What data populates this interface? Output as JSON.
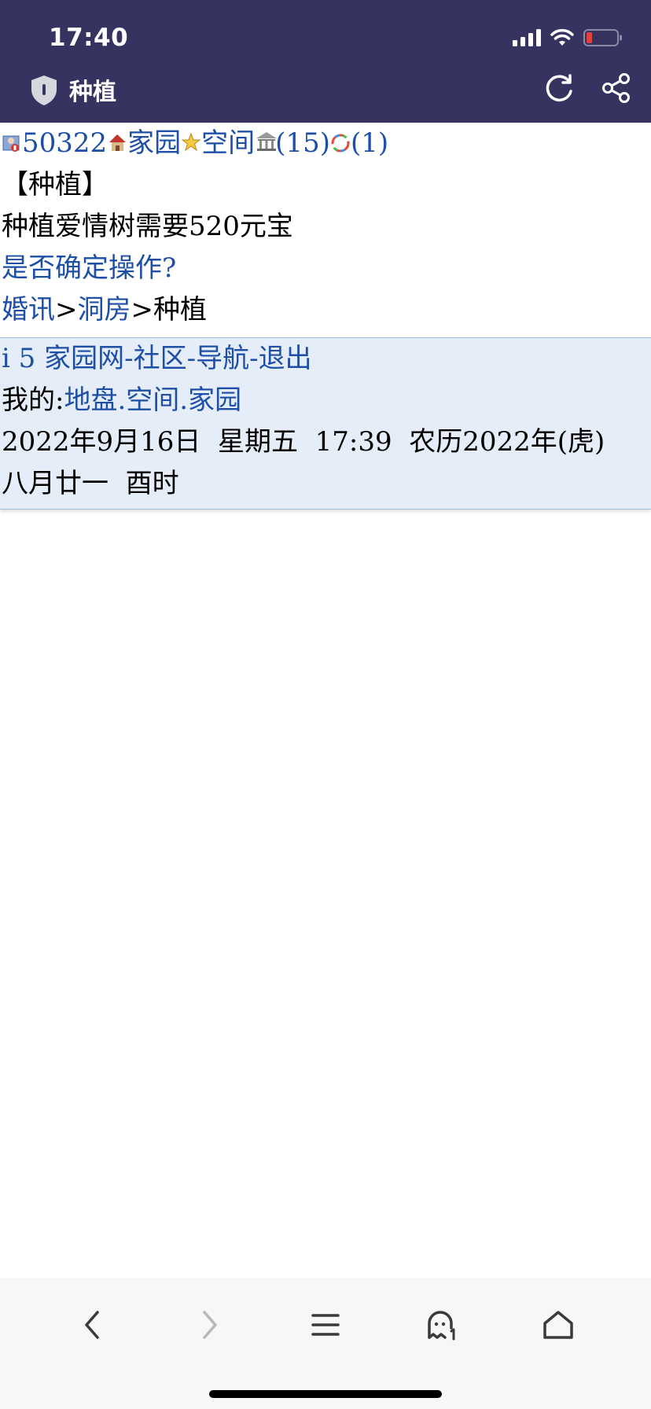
{
  "status_bar": {
    "time": "17:40"
  },
  "title_bar": {
    "title": "种植"
  },
  "content": {
    "user_line": {
      "id": "50322",
      "home": "家园",
      "space": "空间",
      "bank_count": "(15)",
      "msg_count": "(1)"
    },
    "heading": "【种植】",
    "cost_text": "种植爱情树需要520元宝",
    "confirm_link": "是否确定操作?",
    "breadcrumb": {
      "item1": "婚讯",
      "sep1": ">",
      "item2": "洞房",
      "sep2": ">",
      "current": "种植"
    }
  },
  "footer": {
    "nav": {
      "site": "i 5 家园网",
      "sep1": "-",
      "community": "社区",
      "sep2": "-",
      "navigation": "导航",
      "sep3": "-",
      "logout": "退出"
    },
    "mine": {
      "label": "我的:",
      "land": "地盘",
      "dot1": ".",
      "space": "空间",
      "dot2": ".",
      "home": "家园"
    },
    "datetime": "2022年9月16日  星期五  17:39  农历2022年(虎)  八月廿一  酉时"
  },
  "colors": {
    "header_bg": "#363360",
    "link": "#1e4fa6",
    "footer_bg": "#e5edf8",
    "battery_low": "#e0433a"
  },
  "icons": [
    "shield-icon",
    "refresh-icon",
    "share-icon",
    "user-icon",
    "house-icon",
    "star-icon",
    "bank-icon",
    "message-icon",
    "back-icon",
    "forward-icon",
    "menu-icon",
    "ghost-icon",
    "home-icon"
  ]
}
